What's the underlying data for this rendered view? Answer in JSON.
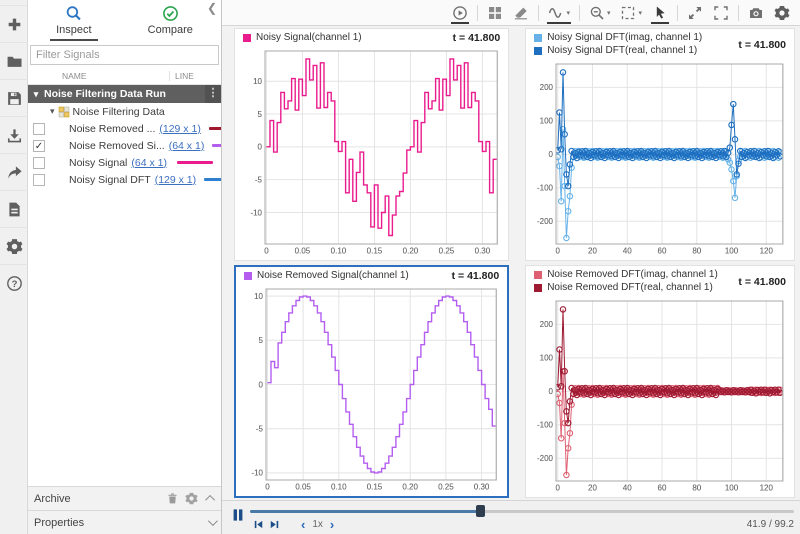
{
  "panel": {
    "tabs": {
      "inspect": "Inspect",
      "compare": "Compare"
    },
    "filter_placeholder": "Filter Signals",
    "columns": {
      "name": "NAME",
      "line": "LINE"
    },
    "run": {
      "label": "Noise Filtering Data Run"
    },
    "group": {
      "label": "Noise Filtering Data"
    },
    "signals": [
      {
        "label": "Noise Removed ...",
        "dims": "(129 x 1)",
        "color": "#a0182e",
        "checked": false
      },
      {
        "label": "Noise Removed Si...",
        "dims": "(64 x 1)",
        "color": "#b45ef0",
        "checked": true
      },
      {
        "label": "Noisy Signal",
        "dims": "(64 x 1)",
        "color": "#ea1b8d",
        "checked": false
      },
      {
        "label": "Noisy Signal DFT",
        "dims": "(129 x 1)",
        "color": "#2e7fd0",
        "checked": false
      }
    ],
    "archive": {
      "label": "Archive"
    },
    "properties": {
      "label": "Properties"
    }
  },
  "sidebar_icons": [
    "add-icon",
    "open-icon",
    "save-icon",
    "import-icon",
    "export-icon",
    "report-icon",
    "preferences-icon",
    "help-icon"
  ],
  "toolbar_icons": [
    "run-playback-icon",
    "subplot-layout-icon",
    "clear-subplots-icon",
    "signals-icon",
    "zoom-icon",
    "fit-to-view-icon",
    "pointer-icon",
    "expand-icon",
    "fullscreen-icon",
    "snapshot-icon",
    "settings-icon"
  ],
  "colors": {
    "selection_border": "#2d6fbf",
    "playback_blue": "#1c4f87",
    "link_blue": "#3b6fbf",
    "inspect_blue": "#2e75c6",
    "compare_green": "#2da44e"
  },
  "playback": {
    "speed": "1x",
    "time": "41.9 / 99.2",
    "progress": 0.422
  },
  "plots": [
    {
      "time_label": "t = 41.800",
      "selected": false,
      "legend": [
        {
          "label": "Noisy Signal(channel 1)",
          "color": "#ea1b8d"
        }
      ],
      "xlim": [
        -0.002,
        0.3205
      ],
      "ylim": [
        -14.8,
        14.6
      ],
      "xticks": [
        0,
        0.05,
        0.1,
        0.15,
        0.2,
        0.25,
        0.3
      ],
      "xtick_labels": [
        "0",
        "0.05",
        "0.10",
        "0.15",
        "0.20",
        "0.25",
        "0.30"
      ],
      "yticks": [
        -10,
        -5,
        0,
        5,
        10
      ],
      "ytick_labels": [
        "-10",
        "-5",
        "0",
        "5",
        "10"
      ],
      "series": [
        {
          "type": "stair",
          "color": "#ea1b8d",
          "dt": 0.005,
          "values": [
            0,
            4,
            -0.8,
            3.7,
            8.3,
            5.8,
            7,
            10.4,
            5.6,
            10.3,
            7.8,
            13.4,
            10.2,
            12.4,
            5.9,
            12.8,
            6,
            8.3,
            7,
            0.8,
            -0.7,
            0.8,
            -7,
            -1.9,
            -8.3,
            -3.9,
            -0.8,
            -5.8,
            -7,
            -12.2,
            -5.8,
            -12.4,
            -10,
            -7.5,
            -13.5,
            -10.4,
            -7.5,
            -6.8,
            -4,
            -0.5,
            0,
            4,
            -0.8,
            3.7,
            8.3,
            5.8,
            7,
            10.4,
            5.6,
            10.3,
            7.8,
            13.4,
            10.2,
            12.4,
            5.9,
            12.8,
            6,
            8.3,
            7,
            0.8,
            -0.7,
            0.8,
            -7,
            -1.9
          ]
        }
      ]
    },
    {
      "time_label": "t = 41.800",
      "selected": false,
      "legend": [
        {
          "label": "Noisy Signal DFT(imag, channel 1)",
          "color": "#66b2e8"
        },
        {
          "label": "Noisy Signal DFT(real, channel 1)",
          "color": "#1e6fc0"
        }
      ],
      "xlim": [
        -1,
        129.5
      ],
      "ylim": [
        -268,
        270
      ],
      "xticks": [
        0,
        20,
        40,
        60,
        80,
        100,
        120
      ],
      "xtick_labels": [
        "0",
        "20",
        "40",
        "60",
        "80",
        "100",
        "120"
      ],
      "yticks": [
        -200,
        -100,
        0,
        100,
        200
      ],
      "ytick_labels": [
        "-200",
        "-100",
        "0",
        "100",
        "200"
      ],
      "series": [
        {
          "type": "linemark",
          "color": "#66b2e8",
          "values": [
            -8,
            -35,
            -140,
            75,
            -95,
            -250,
            -170,
            -125,
            -40,
            -7,
            9,
            -4,
            10,
            -8,
            5,
            -10,
            6,
            -7,
            9,
            -4,
            10,
            -8,
            5,
            -10,
            6,
            -7,
            9,
            -4,
            10,
            -8,
            5,
            -10,
            6,
            -7,
            9,
            -4,
            10,
            -8,
            5,
            -10,
            6,
            -7,
            9,
            -4,
            10,
            -8,
            5,
            -10,
            6,
            -7,
            9,
            -4,
            10,
            -8,
            5,
            -10,
            6,
            -7,
            9,
            -4,
            10,
            -8,
            5,
            -10,
            6,
            -7,
            9,
            -4,
            10,
            -8,
            5,
            -10,
            6,
            -7,
            9,
            -4,
            10,
            -8,
            5,
            -10,
            6,
            -7,
            9,
            -4,
            10,
            -8,
            5,
            -10,
            6,
            -7,
            9,
            -4,
            10,
            -8,
            5,
            -10,
            6,
            -7,
            -15,
            -25,
            -45,
            -80,
            -130,
            -65,
            -20,
            -7,
            9,
            -4,
            10,
            -8,
            5,
            -10,
            6,
            -7,
            9,
            -4,
            10,
            -8,
            5,
            -10,
            6,
            -7,
            9,
            -4,
            10,
            -8,
            5,
            -10,
            6
          ]
        },
        {
          "type": "linemark",
          "color": "#1e6fc0",
          "values": [
            12,
            125,
            15,
            245,
            60,
            -60,
            -95,
            -30,
            10,
            -8,
            4,
            -11,
            7,
            -3,
            9,
            -6,
            10,
            -8,
            4,
            -11,
            7,
            -3,
            9,
            -6,
            10,
            -8,
            4,
            -11,
            7,
            -3,
            9,
            -6,
            10,
            -8,
            4,
            -11,
            7,
            -3,
            9,
            -6,
            10,
            -8,
            4,
            -11,
            7,
            -3,
            9,
            -6,
            10,
            -8,
            4,
            -11,
            7,
            -3,
            9,
            -6,
            10,
            -8,
            4,
            -11,
            7,
            -3,
            9,
            -6,
            10,
            -8,
            4,
            -11,
            7,
            -3,
            9,
            -6,
            10,
            -8,
            4,
            -11,
            7,
            -3,
            9,
            -6,
            10,
            -8,
            4,
            -11,
            7,
            -3,
            9,
            -6,
            10,
            -8,
            4,
            -11,
            7,
            -3,
            9,
            -6,
            10,
            -8,
            4,
            20,
            88,
            150,
            45,
            -60,
            -28,
            10,
            -8,
            4,
            -11,
            7,
            -3,
            9,
            -6,
            10,
            -8,
            4,
            -11,
            7,
            -3,
            9,
            -6,
            10,
            -8,
            4,
            -11,
            7,
            -3,
            9,
            -6
          ]
        }
      ]
    },
    {
      "time_label": "t = 41.800",
      "selected": true,
      "legend": [
        {
          "label": "Noise Removed Signal(channel 1)",
          "color": "#b45ef0"
        }
      ],
      "xlim": [
        -0.002,
        0.3205
      ],
      "ylim": [
        -10.8,
        10.8
      ],
      "xticks": [
        0,
        0.05,
        0.1,
        0.15,
        0.2,
        0.25,
        0.3
      ],
      "xtick_labels": [
        "0",
        "0.05",
        "0.10",
        "0.15",
        "0.20",
        "0.25",
        "0.30"
      ],
      "yticks": [
        -10,
        -5,
        0,
        5,
        10
      ],
      "ytick_labels": [
        "-10",
        "-5",
        "0",
        "5",
        "10"
      ],
      "series": [
        {
          "type": "stair",
          "color": "#b45ef0",
          "dt": 0.005,
          "values": [
            0.2,
            2.6,
            1.9,
            4.7,
            5.9,
            7.1,
            8.1,
            8.9,
            9.5,
            9.9,
            10,
            9.9,
            9.5,
            8.9,
            8.1,
            7.1,
            5.9,
            4.5,
            3.1,
            1.6,
            0,
            -1.6,
            -3.1,
            -4.5,
            -5.9,
            -7.1,
            -8.1,
            -8.9,
            -9.5,
            -9.9,
            -10,
            -9.9,
            -9.5,
            -8.9,
            -8.1,
            -7.1,
            -5.9,
            -4.5,
            -3.1,
            -1.6,
            0,
            1.6,
            3.1,
            4.5,
            5.9,
            7.1,
            8.1,
            8.9,
            9.5,
            9.9,
            10,
            9.9,
            9.5,
            8.9,
            8.1,
            7.1,
            5.9,
            4.5,
            3.1,
            1.6,
            0,
            -1.6,
            -2.8,
            -4.7
          ]
        }
      ]
    },
    {
      "time_label": "t = 41.800",
      "selected": false,
      "legend": [
        {
          "label": "Noise Removed DFT(imag, channel 1)",
          "color": "#de6072"
        },
        {
          "label": "Noise Removed DFT(real, channel 1)",
          "color": "#9e1a32"
        }
      ],
      "xlim": [
        -1,
        129.5
      ],
      "ylim": [
        -268,
        270
      ],
      "xticks": [
        0,
        20,
        40,
        60,
        80,
        100,
        120
      ],
      "xtick_labels": [
        "0",
        "20",
        "40",
        "60",
        "80",
        "100",
        "120"
      ],
      "yticks": [
        -200,
        -100,
        0,
        100,
        200
      ],
      "ytick_labels": [
        "-200",
        "-100",
        "0",
        "100",
        "200"
      ],
      "series": [
        {
          "type": "linemark",
          "color": "#de6072",
          "values": [
            -8,
            -35,
            -140,
            60,
            -95,
            -250,
            -170,
            -125,
            -40,
            -7,
            9,
            -4,
            10,
            -8,
            5,
            -10,
            6,
            -7,
            9,
            -4,
            10,
            -8,
            5,
            -10,
            6,
            -7,
            9,
            -4,
            10,
            -8,
            5,
            -10,
            6,
            -7,
            9,
            -4,
            10,
            -8,
            5,
            -10,
            6,
            -7,
            9,
            -4,
            10,
            -8,
            5,
            -10,
            6,
            -7,
            9,
            -4,
            10,
            -8,
            5,
            -10,
            6,
            -7,
            9,
            -4,
            10,
            -8,
            5,
            -10,
            6,
            -7,
            9,
            -4,
            10,
            -8,
            5,
            -10,
            6,
            -7,
            9,
            -4,
            10,
            -8,
            5,
            -10,
            6,
            -7,
            9,
            -4,
            10,
            -8,
            5,
            -10,
            6,
            -7,
            9,
            -4,
            10,
            -2,
            3,
            -2,
            2,
            -2,
            3,
            -2,
            2,
            -2,
            3,
            -2,
            2,
            -2,
            3,
            -2,
            2,
            -2,
            3,
            -4,
            5,
            -2,
            5,
            -4,
            3,
            -5,
            3,
            -4,
            5,
            -2,
            5,
            -4,
            3,
            -5,
            3,
            -4,
            5
          ]
        },
        {
          "type": "linemark",
          "color": "#9e1a32",
          "values": [
            12,
            125,
            15,
            245,
            60,
            -60,
            -95,
            -30,
            10,
            -8,
            4,
            -11,
            7,
            -3,
            9,
            -6,
            10,
            -8,
            4,
            -11,
            7,
            -3,
            9,
            -6,
            10,
            -8,
            4,
            -11,
            7,
            -3,
            9,
            -6,
            10,
            -8,
            4,
            -11,
            7,
            -3,
            9,
            -6,
            10,
            -8,
            4,
            -11,
            7,
            -3,
            9,
            -6,
            10,
            -8,
            4,
            -11,
            7,
            -3,
            9,
            -6,
            10,
            -8,
            4,
            -11,
            7,
            -3,
            9,
            -6,
            10,
            -8,
            4,
            -11,
            7,
            -3,
            9,
            -6,
            10,
            -8,
            4,
            -11,
            7,
            -3,
            9,
            -6,
            10,
            -8,
            4,
            -11,
            7,
            -3,
            9,
            -6,
            10,
            -8,
            4,
            -11,
            7,
            3,
            -2,
            2,
            -3,
            3,
            -2,
            2,
            -3,
            3,
            -2,
            2,
            -3,
            3,
            -2,
            2,
            -3,
            3,
            -2,
            5,
            -4,
            2,
            -6,
            4,
            -2,
            5,
            -3,
            5,
            -4,
            2,
            -6,
            4,
            -2,
            5,
            -3,
            5,
            -4
          ]
        }
      ]
    }
  ]
}
